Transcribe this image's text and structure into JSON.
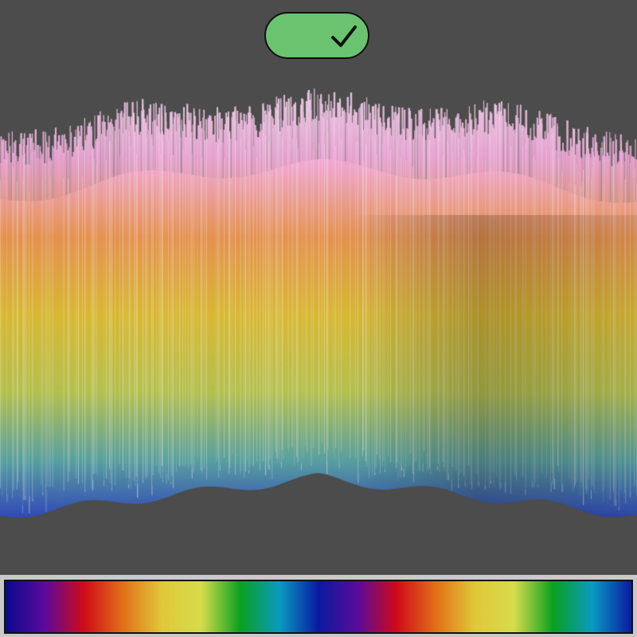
{
  "toggle": {
    "state": "on",
    "icon": "checkmark-icon",
    "color": "#6ac46f"
  },
  "colormap": {
    "stops": [
      "#0a0a90",
      "#5a0a9a",
      "#d00a1a",
      "#e07018",
      "#e0c83a",
      "#d6dc4a",
      "#0aa020",
      "#0a9ac0",
      "#0a1aa0"
    ],
    "repeats": 2
  },
  "background": "#4b4c4b"
}
